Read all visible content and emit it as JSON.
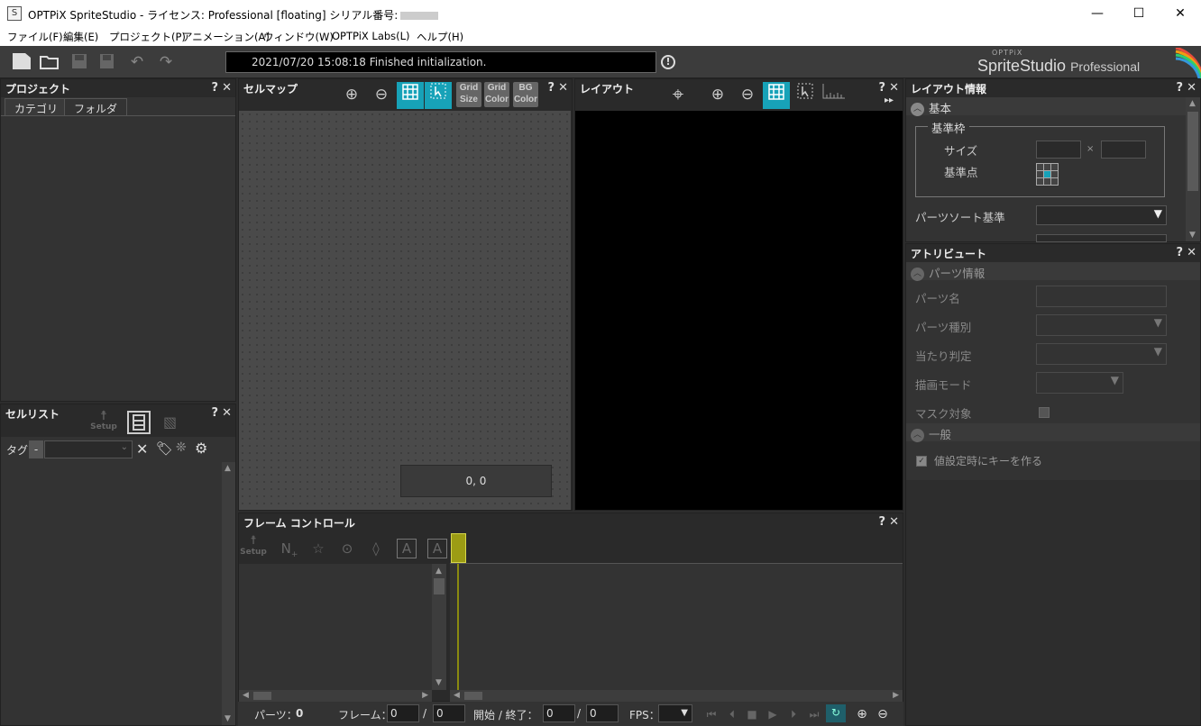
{
  "window": {
    "app_icon": "S",
    "title": "OPTPiX SpriteStudio - ライセンス: Professional [floating]  シリアル番号:",
    "controls": {
      "minimize": "—",
      "maximize": "☐",
      "close": "✕"
    }
  },
  "menu": [
    "ファイル(F)",
    "編集(E)",
    "プロジェクト(P)",
    "アニメーション(A)",
    "ウィンドウ(W)",
    "OPTPiX Labs(L)",
    "ヘルプ(H)"
  ],
  "toolbar": {
    "status_text": "2021/07/20 15:08:18   Finished initialization.",
    "alert_icon": "!",
    "logo_small": "OPTPiX",
    "logo_main": "SpriteStudio",
    "logo_edition": "Professional"
  },
  "panel_controls": {
    "help": "?",
    "close": "✕"
  },
  "project_panel": {
    "title": "プロジェクト",
    "tabs": [
      "カテゴリ",
      "フォルダ"
    ]
  },
  "cell_list_panel": {
    "title": "セルリスト",
    "setup_label": "Setup",
    "tag_label": "タグ",
    "tag_value": "-"
  },
  "cell_map_panel": {
    "title": "セルマップ",
    "grid_size_label": "Grid Size",
    "grid_color_label": "Grid Color",
    "bg_color_label": "BG Color",
    "coord_readout": "0, 0"
  },
  "layout_panel": {
    "title": "レイアウト",
    "more": "▸▸"
  },
  "layout_info_panel": {
    "title": "レイアウト情報",
    "section_basic": "基本",
    "group_reference_frame": "基準枠",
    "size_label": "サイズ",
    "size_separator": "×",
    "anchor_label": "基準点",
    "parts_sort_label": "パーツソート基準"
  },
  "attribute_panel": {
    "title": "アトリビュート",
    "section_parts_info": "パーツ情報",
    "parts_name_label": "パーツ名",
    "parts_type_label": "パーツ種別",
    "collision_label": "当たり判定",
    "draw_mode_label": "描画モード",
    "mask_target_label": "マスク対象",
    "section_general": "一般",
    "create_key_label": "値設定時にキーを作る",
    "create_key_checked": true
  },
  "frame_control_panel": {
    "title": "フレーム コントロール",
    "setup_label": "Setup"
  },
  "bottom_bar": {
    "parts_label": "パーツ：",
    "parts_value": "0",
    "frame_label": "フレーム：",
    "frame_current": "0",
    "frame_sep": "/",
    "frame_total": "0",
    "range_label": "開始 / 終了：",
    "range_start": "0",
    "range_sep": "/",
    "range_end": "0",
    "fps_label": "FPS："
  },
  "colors": {
    "accent": "#17a2b8",
    "playhead": "#9c9c14",
    "panel_bg": "#333333",
    "header_bg": "#2a2a2a"
  }
}
